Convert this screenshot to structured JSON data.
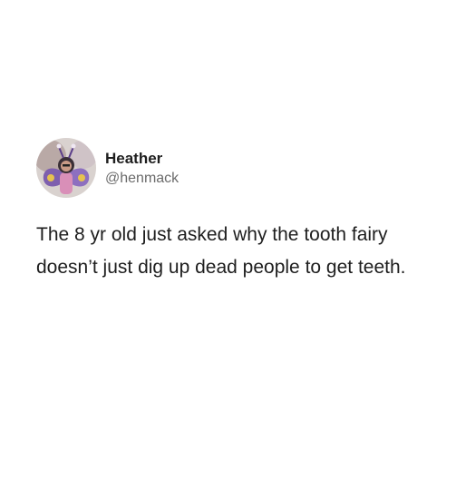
{
  "tweet": {
    "author": {
      "display_name": "Heather",
      "handle": "@henmack",
      "avatar_icon": "profile-photo-avatar"
    },
    "text": "The 8 yr old just asked why the tooth fairy doesn’t just dig up dead people to get teeth."
  },
  "colors": {
    "background": "#ffffff",
    "text": "#1e1e1e",
    "handle": "#6b6b6b"
  }
}
